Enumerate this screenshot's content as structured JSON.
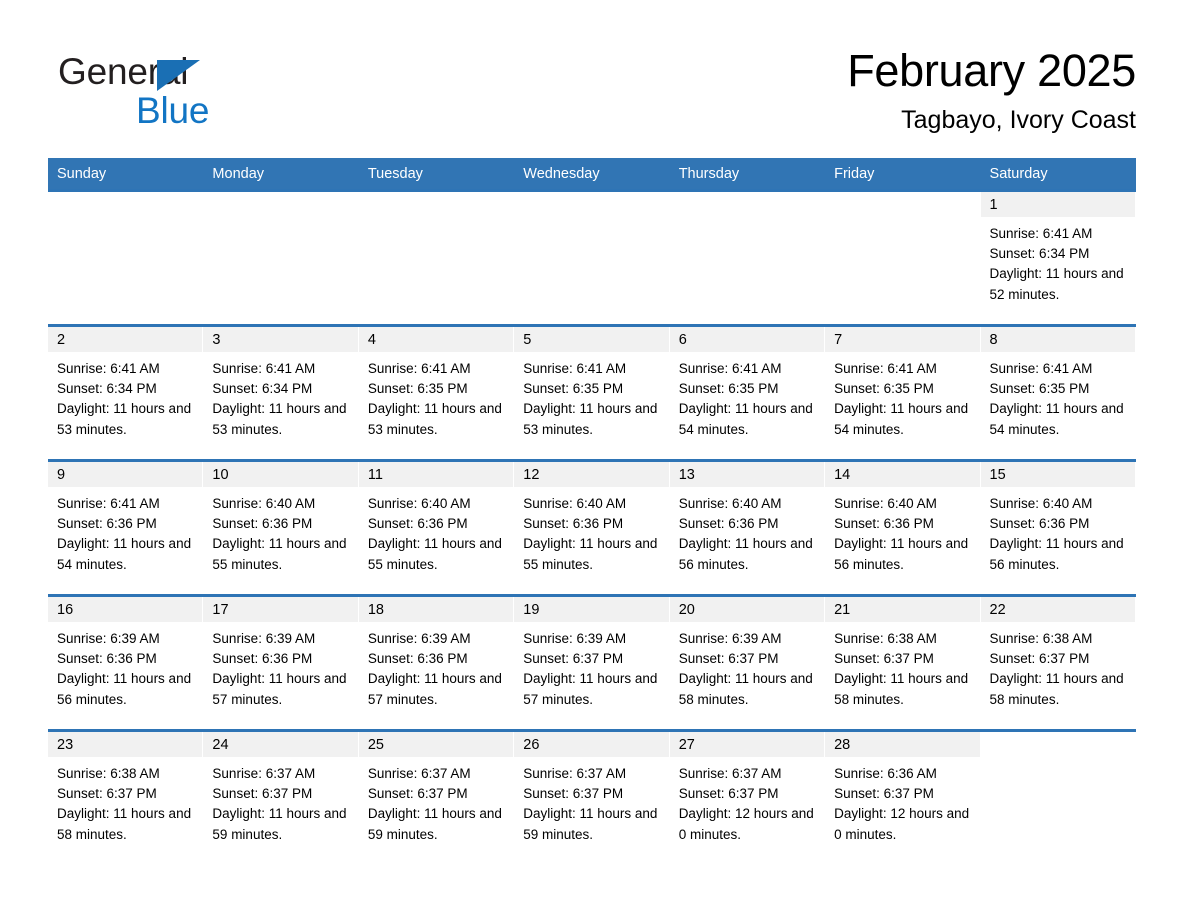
{
  "logo": {
    "word1": "General",
    "word2": "Blue",
    "triangle_color": "#1a6fb4",
    "blue_text_color": "#1275c4"
  },
  "header": {
    "month_title": "February 2025",
    "location": "Tagbayo, Ivory Coast",
    "header_bg_color": "#3175b4",
    "row_divider_color": "#2e74b5",
    "daynum_band_color": "#f1f1f1"
  },
  "weekday_headers": [
    "Sunday",
    "Monday",
    "Tuesday",
    "Wednesday",
    "Thursday",
    "Friday",
    "Saturday"
  ],
  "weeks": [
    [
      {
        "day": "",
        "blank": true
      },
      {
        "day": "",
        "blank": true
      },
      {
        "day": "",
        "blank": true
      },
      {
        "day": "",
        "blank": true
      },
      {
        "day": "",
        "blank": true
      },
      {
        "day": "",
        "blank": true
      },
      {
        "day": "1",
        "sunrise": "Sunrise: 6:41 AM",
        "sunset": "Sunset: 6:34 PM",
        "daylight": "Daylight: 11 hours and 52 minutes."
      }
    ],
    [
      {
        "day": "2",
        "sunrise": "Sunrise: 6:41 AM",
        "sunset": "Sunset: 6:34 PM",
        "daylight": "Daylight: 11 hours and 53 minutes."
      },
      {
        "day": "3",
        "sunrise": "Sunrise: 6:41 AM",
        "sunset": "Sunset: 6:34 PM",
        "daylight": "Daylight: 11 hours and 53 minutes."
      },
      {
        "day": "4",
        "sunrise": "Sunrise: 6:41 AM",
        "sunset": "Sunset: 6:35 PM",
        "daylight": "Daylight: 11 hours and 53 minutes."
      },
      {
        "day": "5",
        "sunrise": "Sunrise: 6:41 AM",
        "sunset": "Sunset: 6:35 PM",
        "daylight": "Daylight: 11 hours and 53 minutes."
      },
      {
        "day": "6",
        "sunrise": "Sunrise: 6:41 AM",
        "sunset": "Sunset: 6:35 PM",
        "daylight": "Daylight: 11 hours and 54 minutes."
      },
      {
        "day": "7",
        "sunrise": "Sunrise: 6:41 AM",
        "sunset": "Sunset: 6:35 PM",
        "daylight": "Daylight: 11 hours and 54 minutes."
      },
      {
        "day": "8",
        "sunrise": "Sunrise: 6:41 AM",
        "sunset": "Sunset: 6:35 PM",
        "daylight": "Daylight: 11 hours and 54 minutes."
      }
    ],
    [
      {
        "day": "9",
        "sunrise": "Sunrise: 6:41 AM",
        "sunset": "Sunset: 6:36 PM",
        "daylight": "Daylight: 11 hours and 54 minutes."
      },
      {
        "day": "10",
        "sunrise": "Sunrise: 6:40 AM",
        "sunset": "Sunset: 6:36 PM",
        "daylight": "Daylight: 11 hours and 55 minutes."
      },
      {
        "day": "11",
        "sunrise": "Sunrise: 6:40 AM",
        "sunset": "Sunset: 6:36 PM",
        "daylight": "Daylight: 11 hours and 55 minutes."
      },
      {
        "day": "12",
        "sunrise": "Sunrise: 6:40 AM",
        "sunset": "Sunset: 6:36 PM",
        "daylight": "Daylight: 11 hours and 55 minutes."
      },
      {
        "day": "13",
        "sunrise": "Sunrise: 6:40 AM",
        "sunset": "Sunset: 6:36 PM",
        "daylight": "Daylight: 11 hours and 56 minutes."
      },
      {
        "day": "14",
        "sunrise": "Sunrise: 6:40 AM",
        "sunset": "Sunset: 6:36 PM",
        "daylight": "Daylight: 11 hours and 56 minutes."
      },
      {
        "day": "15",
        "sunrise": "Sunrise: 6:40 AM",
        "sunset": "Sunset: 6:36 PM",
        "daylight": "Daylight: 11 hours and 56 minutes."
      }
    ],
    [
      {
        "day": "16",
        "sunrise": "Sunrise: 6:39 AM",
        "sunset": "Sunset: 6:36 PM",
        "daylight": "Daylight: 11 hours and 56 minutes."
      },
      {
        "day": "17",
        "sunrise": "Sunrise: 6:39 AM",
        "sunset": "Sunset: 6:36 PM",
        "daylight": "Daylight: 11 hours and 57 minutes."
      },
      {
        "day": "18",
        "sunrise": "Sunrise: 6:39 AM",
        "sunset": "Sunset: 6:36 PM",
        "daylight": "Daylight: 11 hours and 57 minutes."
      },
      {
        "day": "19",
        "sunrise": "Sunrise: 6:39 AM",
        "sunset": "Sunset: 6:37 PM",
        "daylight": "Daylight: 11 hours and 57 minutes."
      },
      {
        "day": "20",
        "sunrise": "Sunrise: 6:39 AM",
        "sunset": "Sunset: 6:37 PM",
        "daylight": "Daylight: 11 hours and 58 minutes."
      },
      {
        "day": "21",
        "sunrise": "Sunrise: 6:38 AM",
        "sunset": "Sunset: 6:37 PM",
        "daylight": "Daylight: 11 hours and 58 minutes."
      },
      {
        "day": "22",
        "sunrise": "Sunrise: 6:38 AM",
        "sunset": "Sunset: 6:37 PM",
        "daylight": "Daylight: 11 hours and 58 minutes."
      }
    ],
    [
      {
        "day": "23",
        "sunrise": "Sunrise: 6:38 AM",
        "sunset": "Sunset: 6:37 PM",
        "daylight": "Daylight: 11 hours and 58 minutes."
      },
      {
        "day": "24",
        "sunrise": "Sunrise: 6:37 AM",
        "sunset": "Sunset: 6:37 PM",
        "daylight": "Daylight: 11 hours and 59 minutes."
      },
      {
        "day": "25",
        "sunrise": "Sunrise: 6:37 AM",
        "sunset": "Sunset: 6:37 PM",
        "daylight": "Daylight: 11 hours and 59 minutes."
      },
      {
        "day": "26",
        "sunrise": "Sunrise: 6:37 AM",
        "sunset": "Sunset: 6:37 PM",
        "daylight": "Daylight: 11 hours and 59 minutes."
      },
      {
        "day": "27",
        "sunrise": "Sunrise: 6:37 AM",
        "sunset": "Sunset: 6:37 PM",
        "daylight": "Daylight: 12 hours and 0 minutes."
      },
      {
        "day": "28",
        "sunrise": "Sunrise: 6:36 AM",
        "sunset": "Sunset: 6:37 PM",
        "daylight": "Daylight: 12 hours and 0 minutes."
      },
      {
        "day": "",
        "blank": true
      }
    ]
  ]
}
